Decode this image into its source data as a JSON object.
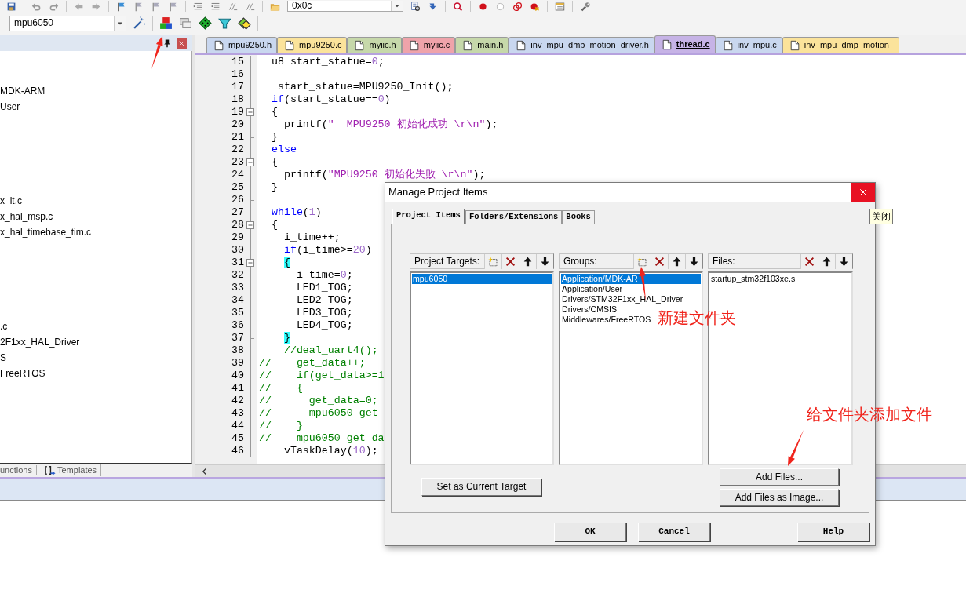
{
  "toolbar_top": {
    "combo_value": "0x0c"
  },
  "toolbar": {
    "target_value": "mpu6050"
  },
  "project_panel": {
    "tree_items": [
      {
        "text": "MDK-ARM"
      },
      {
        "text": "User"
      },
      {
        "text": "x_it.c"
      },
      {
        "text": "x_hal_msp.c"
      },
      {
        "text": "x_hal_timebase_tim.c"
      },
      {
        "text": ".c"
      },
      {
        "text": "2F1xx_HAL_Driver"
      },
      {
        "text": "S"
      },
      {
        "text": "FreeRTOS"
      }
    ],
    "bottom_tabs": [
      {
        "label": "unctions",
        "selected": false
      },
      {
        "label": "Templates",
        "selected": false
      }
    ]
  },
  "editor": {
    "tabs": [
      {
        "label": "mpu9250.h",
        "color": "#c9d7ef",
        "selected": false
      },
      {
        "label": "mpu9250.c",
        "color": "#fbe39b",
        "selected": false
      },
      {
        "label": "myiic.h",
        "color": "#c6d8aa",
        "selected": false
      },
      {
        "label": "myiic.c",
        "color": "#efa3aa",
        "selected": false
      },
      {
        "label": "main.h",
        "color": "#c6d8aa",
        "selected": false
      },
      {
        "label": "inv_mpu_dmp_motion_driver.h",
        "color": "#c9d7ef",
        "selected": false
      },
      {
        "label": "thread.c",
        "color": "#c6b3e6",
        "selected": true
      },
      {
        "label": "inv_mpu.c",
        "color": "#c9d7ef",
        "selected": false
      },
      {
        "label": "inv_mpu_dmp_motion_",
        "color": "#fbe39b",
        "selected": false
      }
    ],
    "lines": [
      {
        "number": "15",
        "collapsible": false,
        "block_end": false,
        "segments": [
          {
            "kind": "plain",
            "text": "  u8 start_statue="
          },
          {
            "kind": "number",
            "text": "0"
          },
          {
            "kind": "plain",
            "text": ";"
          }
        ]
      },
      {
        "number": "16",
        "collapsible": false,
        "block_end": false
      },
      {
        "number": "17",
        "collapsible": false,
        "block_end": false,
        "segments": [
          {
            "kind": "plain",
            "text": "   start_statue=MPU9250_Init();"
          }
        ]
      },
      {
        "number": "18",
        "collapsible": false,
        "block_end": false,
        "segments": [
          {
            "kind": "keyword",
            "text": "  if"
          },
          {
            "kind": "plain",
            "text": "(start_statue=="
          },
          {
            "kind": "number",
            "text": "0"
          },
          {
            "kind": "plain",
            "text": ")"
          }
        ]
      },
      {
        "number": "19",
        "collapsible": true,
        "block_end": false,
        "segments": [
          {
            "kind": "plain",
            "text": "  {"
          }
        ]
      },
      {
        "number": "20",
        "collapsible": false,
        "block_end": false,
        "segments": [
          {
            "kind": "plain",
            "text": "    printf("
          },
          {
            "kind": "string",
            "text": "\"  MPU9250 初始化成功 \\r\\n\""
          },
          {
            "kind": "plain",
            "text": ");"
          }
        ]
      },
      {
        "number": "21",
        "collapsible": false,
        "block_end": true,
        "segments": [
          {
            "kind": "plain",
            "text": "  }"
          }
        ]
      },
      {
        "number": "22",
        "collapsible": false,
        "block_end": false,
        "segments": [
          {
            "kind": "keyword",
            "text": "  else"
          }
        ]
      },
      {
        "number": "23",
        "collapsible": true,
        "block_end": false,
        "segments": [
          {
            "kind": "plain",
            "text": "  {"
          }
        ]
      },
      {
        "number": "24",
        "collapsible": false,
        "block_end": false,
        "segments": [
          {
            "kind": "plain",
            "text": "    printf("
          },
          {
            "kind": "string",
            "text": "\"MPU9250 初始化失败 \\r\\n\""
          },
          {
            "kind": "plain",
            "text": ");"
          }
        ]
      },
      {
        "number": "25",
        "collapsible": false,
        "block_end": false,
        "segments": [
          {
            "kind": "plain",
            "text": "  }"
          }
        ]
      },
      {
        "number": "26",
        "collapsible": false,
        "block_end": true
      },
      {
        "number": "27",
        "collapsible": false,
        "block_end": false,
        "segments": [
          {
            "kind": "keyword",
            "text": "  while"
          },
          {
            "kind": "plain",
            "text": "("
          },
          {
            "kind": "number",
            "text": "1"
          },
          {
            "kind": "plain",
            "text": ")"
          }
        ]
      },
      {
        "number": "28",
        "collapsible": true,
        "block_end": false,
        "segments": [
          {
            "kind": "plain",
            "text": "  {"
          }
        ]
      },
      {
        "number": "29",
        "collapsible": false,
        "block_end": false,
        "segments": [
          {
            "kind": "plain",
            "text": "    i_time++;"
          }
        ]
      },
      {
        "number": "30",
        "collapsible": false,
        "block_end": false,
        "segments": [
          {
            "kind": "keyword",
            "text": "    if"
          },
          {
            "kind": "plain",
            "text": "(i_time>="
          },
          {
            "kind": "number",
            "text": "20"
          },
          {
            "kind": "plain",
            "text": ")"
          }
        ]
      },
      {
        "number": "31",
        "collapsible": true,
        "block_end": false,
        "segments": [
          {
            "kind": "match",
            "text": "    {"
          }
        ]
      },
      {
        "number": "32",
        "collapsible": false,
        "block_end": false,
        "segments": [
          {
            "kind": "plain",
            "text": "      i_time="
          },
          {
            "kind": "number",
            "text": "0"
          },
          {
            "kind": "plain",
            "text": ";"
          }
        ]
      },
      {
        "number": "33",
        "collapsible": false,
        "block_end": false,
        "segments": [
          {
            "kind": "plain",
            "text": "      LED1_TOG;"
          }
        ]
      },
      {
        "number": "34",
        "collapsible": false,
        "block_end": false,
        "segments": [
          {
            "kind": "plain",
            "text": "      LED2_TOG;"
          }
        ]
      },
      {
        "number": "35",
        "collapsible": false,
        "block_end": false,
        "segments": [
          {
            "kind": "plain",
            "text": "      LED3_TOG;"
          }
        ]
      },
      {
        "number": "36",
        "collapsible": false,
        "block_end": false,
        "segments": [
          {
            "kind": "plain",
            "text": "      LED4_TOG;"
          }
        ]
      },
      {
        "number": "37",
        "collapsible": false,
        "block_end": true,
        "segments": [
          {
            "kind": "match",
            "text": "    }"
          }
        ]
      },
      {
        "number": "38",
        "collapsible": false,
        "block_end": false,
        "segments": [
          {
            "kind": "comment",
            "text": "    //deal_uart4();"
          }
        ]
      },
      {
        "number": "39",
        "collapsible": false,
        "block_end": false,
        "segments": [
          {
            "kind": "comment",
            "text": "//    get_data++;"
          }
        ]
      },
      {
        "number": "40",
        "collapsible": false,
        "block_end": false,
        "segments": [
          {
            "kind": "comment",
            "text": "//    if(get_data>=1"
          }
        ]
      },
      {
        "number": "41",
        "collapsible": false,
        "block_end": false,
        "segments": [
          {
            "kind": "comment",
            "text": "//    {"
          }
        ]
      },
      {
        "number": "42",
        "collapsible": false,
        "block_end": false,
        "segments": [
          {
            "kind": "comment",
            "text": "//      get_data=0;"
          }
        ]
      },
      {
        "number": "43",
        "collapsible": false,
        "block_end": false,
        "segments": [
          {
            "kind": "comment",
            "text": "//      mpu6050_get_"
          }
        ]
      },
      {
        "number": "44",
        "collapsible": false,
        "block_end": false,
        "segments": [
          {
            "kind": "comment",
            "text": "//    }"
          }
        ]
      },
      {
        "number": "45",
        "collapsible": false,
        "block_end": false,
        "segments": [
          {
            "kind": "comment",
            "text": "//    mpu6050_get_da"
          }
        ]
      },
      {
        "number": "46",
        "collapsible": false,
        "block_end": false,
        "segments": [
          {
            "kind": "plain",
            "text": "    vTaskDelay("
          },
          {
            "kind": "number",
            "text": "10"
          },
          {
            "kind": "plain",
            "text": ");"
          }
        ]
      }
    ]
  },
  "dialog": {
    "title": "Manage Project Items",
    "tabs": [
      {
        "label": "Project Items",
        "selected": true
      },
      {
        "label": "Folders/Extensions",
        "selected": false
      },
      {
        "label": "Books",
        "selected": false
      }
    ],
    "panels": [
      {
        "label": "Project Targets:",
        "tools": [
          {
            "kind": "new"
          },
          {
            "kind": "delete"
          },
          {
            "kind": "up"
          },
          {
            "kind": "down"
          }
        ],
        "items": [
          {
            "text": "mpu6050",
            "selected": true
          }
        ],
        "buttons": [
          "Set as Current Target"
        ]
      },
      {
        "label": "Groups:",
        "tools": [
          {
            "kind": "new"
          },
          {
            "kind": "delete"
          },
          {
            "kind": "up"
          },
          {
            "kind": "down"
          }
        ],
        "items": [
          {
            "text": "Application/MDK-AR",
            "selected": true
          },
          {
            "text": "Application/User",
            "selected": false
          },
          {
            "text": "Drivers/STM32F1xx_HAL_Driver",
            "selected": false
          },
          {
            "text": "Drivers/CMSIS",
            "selected": false
          },
          {
            "text": "Middlewares/FreeRTOS",
            "selected": false
          }
        ]
      },
      {
        "label": "Files:",
        "tools": [
          {
            "kind": "delete"
          },
          {
            "kind": "up"
          },
          {
            "kind": "down"
          }
        ],
        "items": [
          {
            "text": "startup_stm32f103xe.s",
            "selected": false
          }
        ],
        "buttons": [
          "Add Files...",
          "Add Files as Image..."
        ]
      }
    ],
    "footer_buttons": [
      "OK",
      "Cancel",
      "Help"
    ]
  },
  "tooltip": {
    "text": "关闭"
  },
  "annotations": [
    {
      "text": "新建文件夹"
    },
    {
      "text": "给文件夹添加文件"
    }
  ]
}
